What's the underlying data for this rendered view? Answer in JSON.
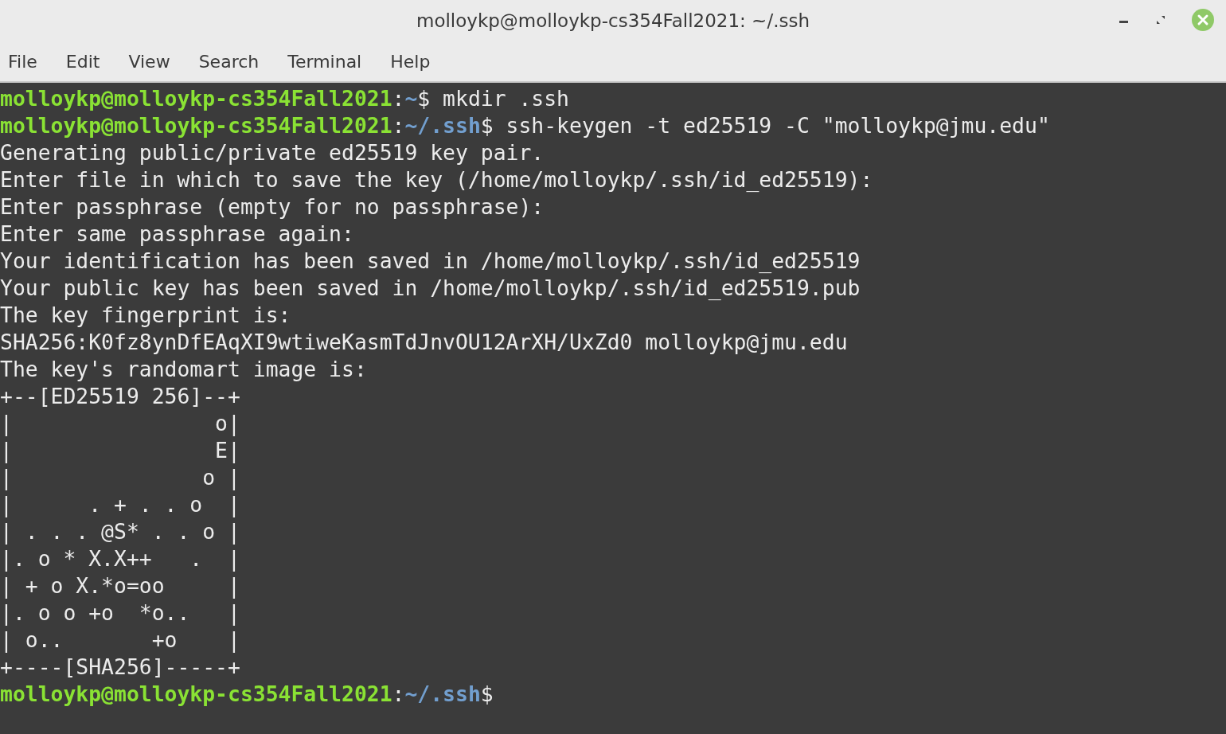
{
  "window": {
    "title": "molloykp@molloykp-cs354Fall2021: ~/.ssh",
    "controls": [
      {
        "kind": "minimize"
      },
      {
        "kind": "maximize"
      },
      {
        "kind": "close"
      }
    ]
  },
  "menu": [
    "File",
    "Edit",
    "View",
    "Search",
    "Terminal",
    "Help"
  ],
  "terminal": {
    "lines": [
      {
        "kind": "prompt",
        "user_host": "molloykp@molloykp-cs354Fall2021",
        "separator": ":",
        "path": "~",
        "symbol": "$",
        "command": " mkdir .ssh"
      },
      {
        "kind": "prompt",
        "user_host": "molloykp@molloykp-cs354Fall2021",
        "separator": ":",
        "path": "~/.ssh",
        "symbol": "$",
        "command": " ssh-keygen -t ed25519 -C \"molloykp@jmu.edu\""
      },
      {
        "kind": "output",
        "text": "Generating public/private ed25519 key pair."
      },
      {
        "kind": "output",
        "text": "Enter file in which to save the key (/home/molloykp/.ssh/id_ed25519):"
      },
      {
        "kind": "output",
        "text": "Enter passphrase (empty for no passphrase):"
      },
      {
        "kind": "output",
        "text": "Enter same passphrase again:"
      },
      {
        "kind": "output",
        "text": "Your identification has been saved in /home/molloykp/.ssh/id_ed25519"
      },
      {
        "kind": "output",
        "text": "Your public key has been saved in /home/molloykp/.ssh/id_ed25519.pub"
      },
      {
        "kind": "output",
        "text": "The key fingerprint is:"
      },
      {
        "kind": "output",
        "text": "SHA256:K0fz8ynDfEAqXI9wtiweKasmTdJnvOU12ArXH/UxZd0 molloykp@jmu.edu"
      },
      {
        "kind": "output",
        "text": "The key's randomart image is:"
      },
      {
        "kind": "output",
        "text": "+--[ED25519 256]--+"
      },
      {
        "kind": "output",
        "text": "|                o|"
      },
      {
        "kind": "output",
        "text": "|                E|"
      },
      {
        "kind": "output",
        "text": "|               o |"
      },
      {
        "kind": "output",
        "text": "|      . + . . o  |"
      },
      {
        "kind": "output",
        "text": "| . . . @S* . . o |"
      },
      {
        "kind": "output",
        "text": "|. o * X.X++   .  |"
      },
      {
        "kind": "output",
        "text": "| + o X.*o=oo     |"
      },
      {
        "kind": "output",
        "text": "|. o o +o  *o..   |"
      },
      {
        "kind": "output",
        "text": "| o..       +o    |"
      },
      {
        "kind": "output",
        "text": "+----[SHA256]-----+"
      },
      {
        "kind": "prompt",
        "user_host": "molloykp@molloykp-cs354Fall2021",
        "separator": ":",
        "path": "~/.ssh",
        "symbol": "$"
      }
    ]
  }
}
